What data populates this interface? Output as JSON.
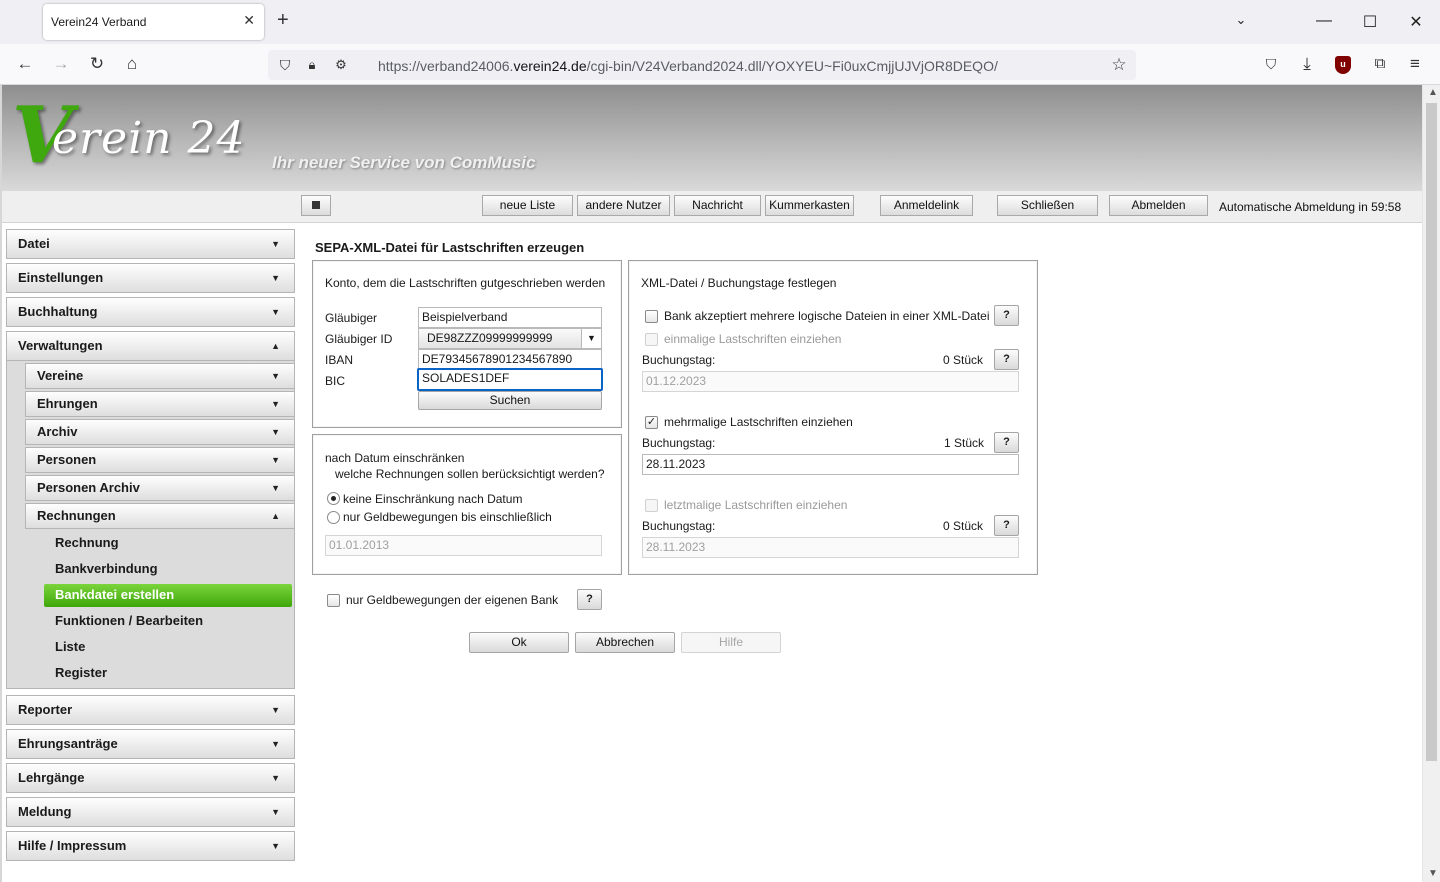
{
  "browser": {
    "tab_title": "Verein24 Verband",
    "url_prefix": "https://verband24006.",
    "url_domain": "verein24.de",
    "url_path": "/cgi-bin/V24Verband2024.dll/YOXYEU~Fi0uxCmjjUJVjOR8DEQO/"
  },
  "banner": {
    "logo_initial": "V",
    "logo_rest": "erein 24",
    "slogan": "Ihr neuer Service von ComMusic"
  },
  "toolbar": {
    "buttons": [
      "neue Liste",
      "andere Nutzer",
      "Nachricht",
      "Kummerkasten",
      "Anmeldelink",
      "Schließen",
      "Abmelden"
    ],
    "auto_logout": "Automatische Abmeldung in 59:58"
  },
  "sidebar": {
    "top": [
      "Datei",
      "Einstellungen",
      "Buchhaltung",
      "Verwaltungen"
    ],
    "verwaltungen_sub": [
      "Vereine",
      "Ehrungen",
      "Archiv",
      "Personen",
      "Personen Archiv",
      "Rechnungen"
    ],
    "rechnungen_leaves": [
      "Rechnung",
      "Bankverbindung",
      "Bankdatei erstellen",
      "Funktionen / Bearbeiten",
      "Liste",
      "Register"
    ],
    "bottom": [
      "Reporter",
      "Ehrungsanträge",
      "Lehrgänge",
      "Meldung",
      "Hilfe / Impressum"
    ]
  },
  "main": {
    "title": "SEPA-XML-Datei für Lastschriften erzeugen",
    "konto": {
      "heading": "Konto, dem die Lastschriften gutgeschrieben werden",
      "glaeubiger_label": "Gläubiger",
      "glaeubiger_value": "Beispielverband",
      "glaeubiger_id_label": "Gläubiger ID",
      "glaeubiger_id_value": "DE98ZZZ09999999999",
      "iban_label": "IBAN",
      "iban_value": "DE79345678901234567890",
      "bic_label": "BIC",
      "bic_value": "SOLADES1DEF",
      "search_button": "Suchen"
    },
    "datum": {
      "heading_line1": "nach Datum einschränken",
      "heading_line2": "welche Rechnungen sollen berücksichtigt werden?",
      "option1": "keine Einschränkung nach Datum",
      "option2": "nur Geldbewegungen bis einschließlich",
      "date_value": "01.01.2013"
    },
    "xml": {
      "heading": "XML-Datei / Buchungstage festlegen",
      "multi_file_label": "Bank akzeptiert mehrere logische Dateien in einer XML-Datei",
      "einmalig_label": "einmalige Lastschriften einziehen",
      "mehrmalig_label": "mehrmalige Lastschriften einziehen",
      "letztmalig_label": "letztmalige Lastschriften einziehen",
      "buchungstag_label": "Buchungstag:",
      "einmalig_count": "0 Stück",
      "einmalig_date": "01.12.2023",
      "mehrmalig_count": "1 Stück",
      "mehrmalig_date": "28.11.2023",
      "letztmalig_count": "0 Stück",
      "letztmalig_date": "28.11.2023",
      "help": "?"
    },
    "own_bank_label": "nur Geldbewegungen der eigenen Bank",
    "ok": "Ok",
    "cancel": "Abbrechen",
    "help_button": "Hilfe"
  }
}
